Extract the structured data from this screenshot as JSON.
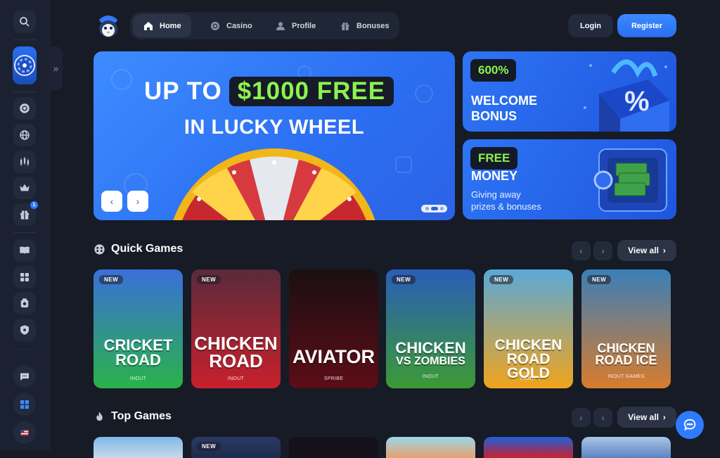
{
  "nav": {
    "items": [
      {
        "label": "Home",
        "icon": "home-icon",
        "active": true
      },
      {
        "label": "Casino",
        "icon": "casino-chip-icon",
        "active": false
      },
      {
        "label": "Profile",
        "icon": "user-icon",
        "active": false
      },
      {
        "label": "Bonuses",
        "icon": "gift-icon",
        "active": false
      }
    ],
    "login": "Login",
    "register": "Register"
  },
  "hero": {
    "line1_prefix": "UP TO",
    "line1_highlight": "$1000 FREE",
    "line2": "IN LUCKY WHEEL",
    "prev": "‹",
    "next": "›"
  },
  "promos": [
    {
      "tag": "600%",
      "title_1": "WELCOME",
      "title_2": "BONUS"
    },
    {
      "tag": "FREE",
      "title_1": "MONEY",
      "sub_1": "Giving away",
      "sub_2": "prizes & bonuses"
    }
  ],
  "quick_games": {
    "title": "Quick Games",
    "view_all": "View all",
    "prev": "‹",
    "next": "›",
    "cards": [
      {
        "badge": "NEW",
        "title_1": "CRICKET",
        "title_2": "ROAD",
        "provider": "INOUT",
        "colors": [
          "#3a6fd8",
          "#29b24a"
        ]
      },
      {
        "badge": "NEW",
        "title_1": "CHICKEN",
        "title_2": "ROAD",
        "provider": "INOUT",
        "colors": [
          "#5a2a3a",
          "#c8202c"
        ]
      },
      {
        "badge": "",
        "title_1": "AVIATOR",
        "title_2": "",
        "provider": "SPRIBE",
        "colors": [
          "#1a0f12",
          "#5c0d16"
        ]
      },
      {
        "badge": "NEW",
        "title_1": "CHICKEN",
        "title_2": "VS ZOMBIES",
        "provider": "INOUT",
        "colors": [
          "#2a5db8",
          "#3c9a34"
        ]
      },
      {
        "badge": "NEW",
        "title_1": "CHICKEN",
        "title_2": "ROAD GOLD",
        "provider": "INOUT",
        "colors": [
          "#5aa8d8",
          "#f0a41c"
        ]
      },
      {
        "badge": "NEW",
        "title_1": "CHICKEN",
        "title_2": "ROAD ICE",
        "provider": "INOUT GAMES",
        "colors": [
          "#3a7fb8",
          "#d87c2c"
        ]
      }
    ]
  },
  "top_games": {
    "title": "Top Games",
    "view_all": "View all",
    "prev": "‹",
    "next": "›",
    "badge_second": "NEW"
  },
  "sidebar": {
    "icons": [
      "search-icon",
      "lucky-wheel-icon",
      "casino-chip-icon",
      "globe-icon",
      "trading-chart-icon",
      "crown-icon",
      "gift-icon",
      "book-icon",
      "puzzle-icon",
      "wallet-icon",
      "shield-icon",
      "support-chat-icon",
      "windows-icon",
      "us-flag-icon"
    ],
    "gift_badge": "1"
  },
  "colors": {
    "accent": "#2f7bff",
    "highlight": "#8df24e",
    "bg": "#161b26"
  }
}
